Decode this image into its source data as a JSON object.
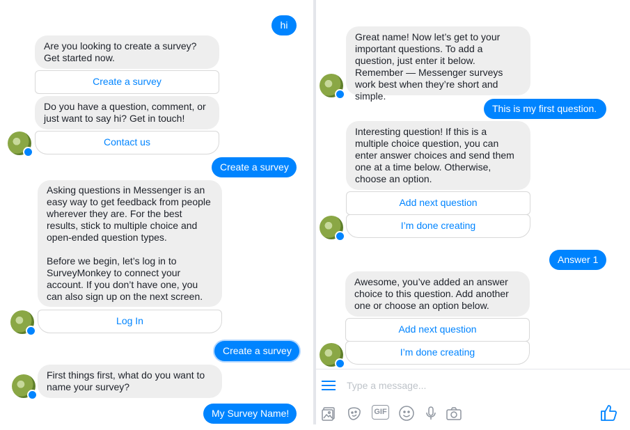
{
  "left": {
    "msg_hi": "hi",
    "msg_intro": "Are you looking to create a survey? Get started now.",
    "btn_create_survey": "Create a survey",
    "msg_contact": "Do you have a question, comment, or just want to say hi? Get in touch!",
    "btn_contact": "Contact us",
    "msg_user_create_1": "Create a survey",
    "msg_login_p1": "Asking questions in Messenger is an easy way to get feedback from people wherever they are. For the best results, stick to multiple choice and open-ended question types.",
    "msg_login_p2": "Before we begin, let’s log in to SurveyMonkey to connect your account. If you don’t have one, you can also sign up on the next screen.",
    "btn_login": "Log In",
    "msg_user_create_2": "Create a survey",
    "msg_name_prompt": "First things first, what do you want to name your survey?",
    "msg_survey_name": "My Survey Name!"
  },
  "right": {
    "msg_great_name": "Great name! Now let’s get to your important questions. To add a question, just enter it below. Remember — Messenger surveys work best when they’re short and simple.",
    "msg_first_question": "This is my first question.",
    "msg_interesting": "Interesting question! If this is a multiple choice question, you can enter answer choices and send them one at a time below. Otherwise, choose an option.",
    "btn_add_next_1": "Add next question",
    "btn_done_1": "I’m done creating",
    "msg_answer1": "Answer 1",
    "msg_awesome": "Awesome, you’ve added an answer choice to this question. Add another one or choose an option below.",
    "btn_add_next_2": "Add next question",
    "btn_done_2": "I’m done creating"
  },
  "composer": {
    "placeholder": "Type a message...",
    "gif_label": "GIF",
    "icons": [
      "menu-icon",
      "image-icon",
      "sticker-icon",
      "gif-icon",
      "emoji-icon",
      "microphone-icon",
      "camera-icon",
      "like-icon"
    ]
  },
  "colors": {
    "accent": "#0084ff",
    "bubble_gray": "#eeeeee",
    "icon_gray": "#8d949e"
  }
}
